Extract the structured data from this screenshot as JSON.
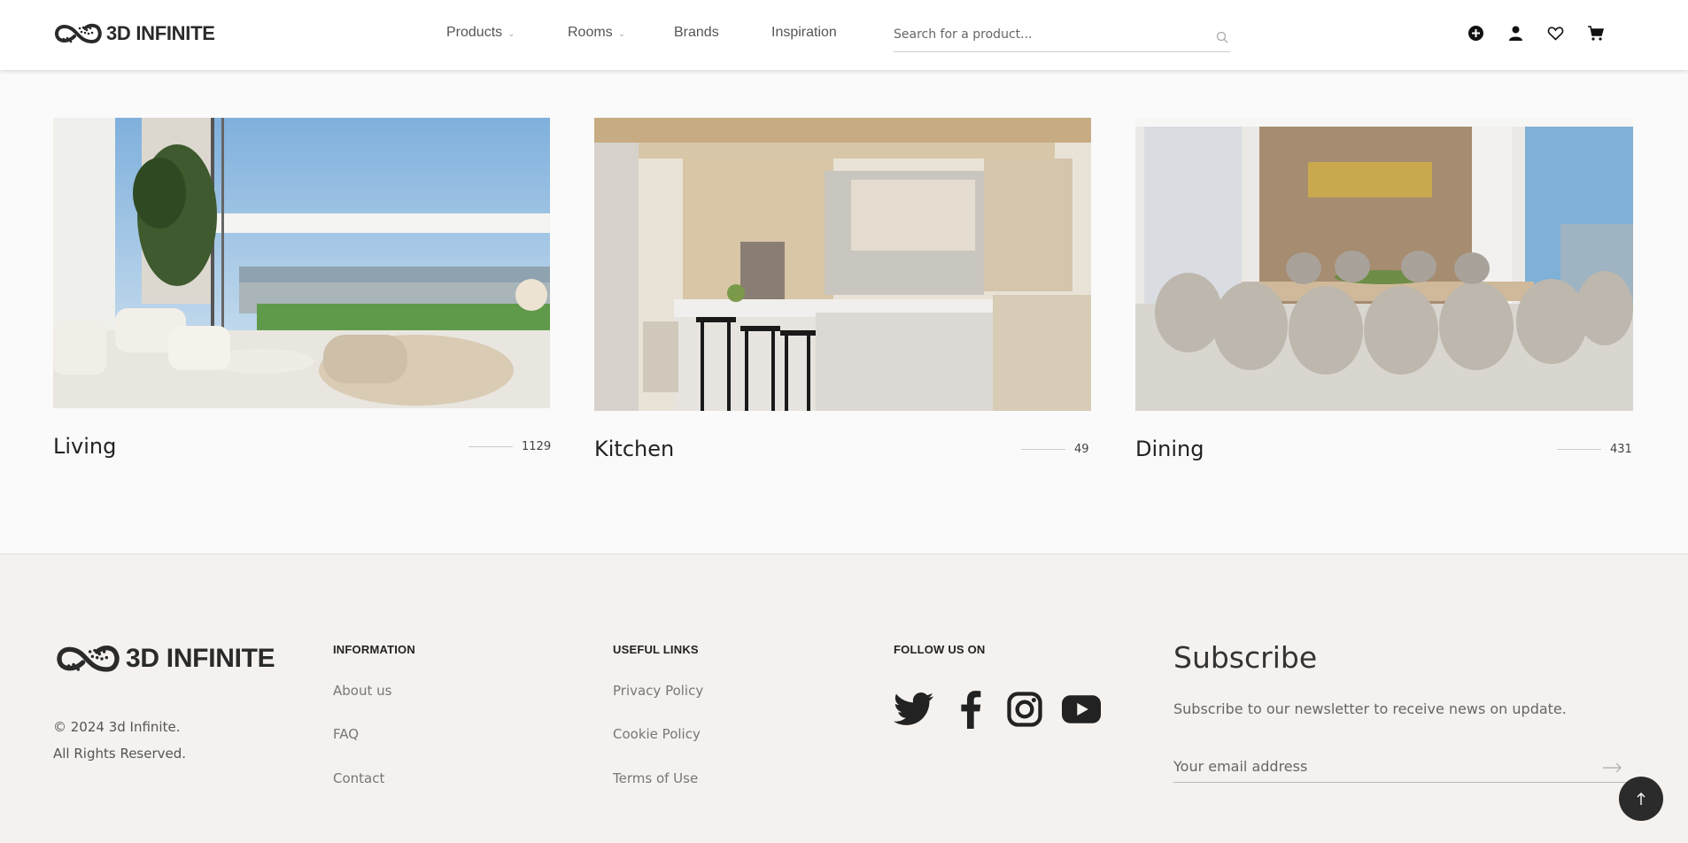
{
  "header": {
    "logo_text": "3D INFINITE",
    "nav": [
      {
        "label": "Products",
        "dropdown": true
      },
      {
        "label": "Rooms",
        "dropdown": true
      },
      {
        "label": "Brands",
        "dropdown": false
      },
      {
        "label": "Inspiration",
        "dropdown": false
      }
    ],
    "search_placeholder": "Search for a product...",
    "icons": [
      "add-circle-icon",
      "user-icon",
      "heart-icon",
      "cart-icon"
    ]
  },
  "rooms": [
    {
      "name": "Living",
      "count": "1129",
      "image": "living-room-photo"
    },
    {
      "name": "Kitchen",
      "count": "49",
      "image": "kitchen-photo"
    },
    {
      "name": "Dining",
      "count": "431",
      "image": "dining-room-photo"
    }
  ],
  "footer": {
    "logo_text": "3D INFINITE",
    "copyright_line1": "© 2024 3d Infinite.",
    "copyright_line2": "All Rights Reserved.",
    "information": {
      "heading": "INFORMATION",
      "links": [
        "About us",
        "FAQ",
        "Contact"
      ]
    },
    "useful_links": {
      "heading": "USEFUL LINKS",
      "links": [
        "Privacy Policy",
        "Cookie Policy",
        "Terms of Use"
      ]
    },
    "follow": {
      "heading": "FOLLOW US ON",
      "icons": [
        "twitter-icon",
        "facebook-icon",
        "instagram-icon",
        "youtube-icon"
      ]
    },
    "subscribe": {
      "title": "Subscribe",
      "text": "Subscribe to our newsletter to receive news on update.",
      "email_placeholder": "Your email address"
    }
  },
  "colors": {
    "dark": "#2b2b2b",
    "footer_bg": "#f4f1ee",
    "page_bg": "#fafafa"
  }
}
